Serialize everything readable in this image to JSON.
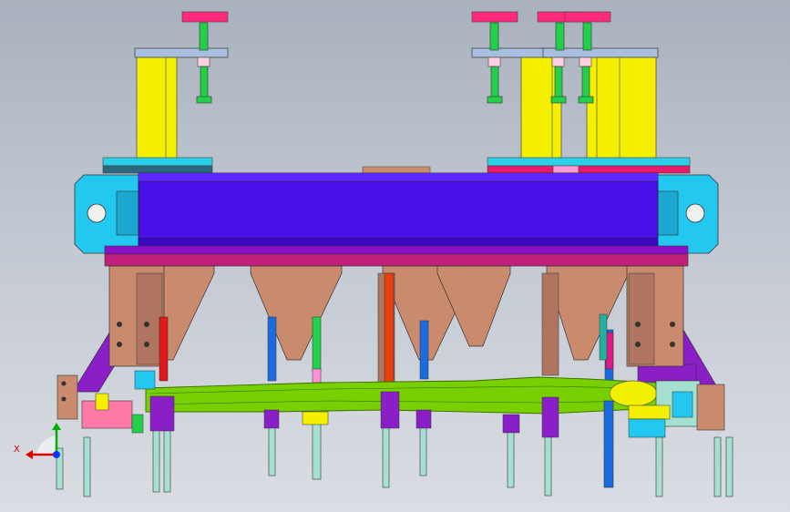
{
  "viewport": {
    "background_top": "#a9b1be",
    "background_bottom": "#dadde3"
  },
  "triad": {
    "axis_label": "X",
    "x_color": "#e00000",
    "y_color": "#00b000",
    "z_color": "#1030ff"
  },
  "colors": {
    "beam": "#4a10e8",
    "end_plate": "#22c8f0",
    "cylinder": "#f4f000",
    "rod": "#22d04a",
    "cap": "#ff2a7a",
    "gusset": "#c98a6e",
    "bracket": "#8a1fc8",
    "workpiece": "#78d000",
    "pin": "#a6e0d0",
    "strip": "#c0207a"
  }
}
